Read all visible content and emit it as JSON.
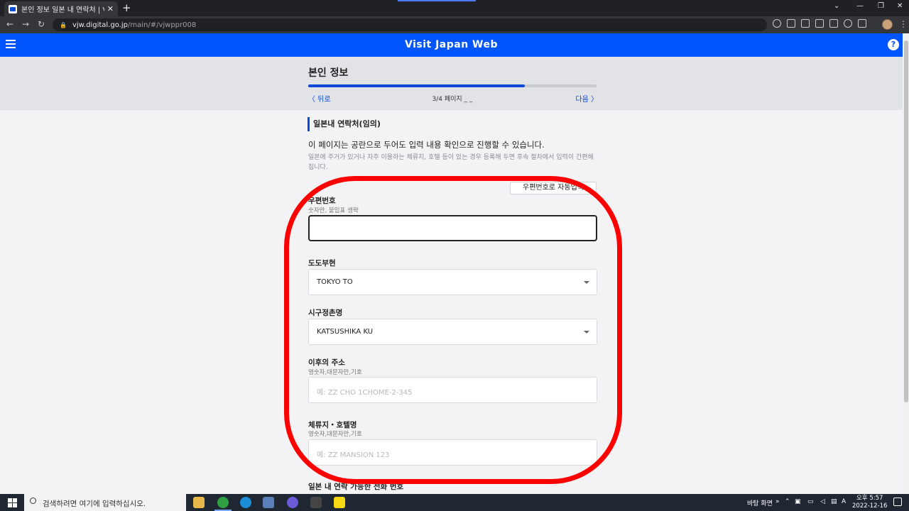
{
  "browser": {
    "tab_title": "본인 정보 일본 내 연락처 | Visit",
    "tab_close": "✕",
    "new_tab": "+",
    "url_host": "vjw.digital.go.jp",
    "url_path": "/main/#/vjwppr008",
    "icons": [
      "google-icon",
      "key-icon",
      "install-icon",
      "translate-icon",
      "share-icon",
      "bookmark-star-icon",
      "sidebar-icon",
      "profile-avatar",
      "menu-icon"
    ]
  },
  "header": {
    "title": "Visit Japan Web",
    "help": "?"
  },
  "step": {
    "heading": "본인 정보",
    "progress": 0.75,
    "back": "〈 뒤로",
    "page_count": "3/4 페이지 _ _",
    "next": "다음 〉"
  },
  "section": {
    "title": "일본내 연락처(임의)",
    "intro": "이 페이지는 공란으로 두어도 입력 내용 확인으로 진행할 수 있습니다.",
    "hint": "일본에 주거가 있거나 자주 이용하는 체류지, 호텔 등이 있는 경우 등록해 두면 후속 절차에서 입력이 간편해집니다."
  },
  "form": {
    "autofill_button": "우편번호로 자동입력",
    "postal": {
      "label": "우편번호",
      "sub": "숫자만, 붙임표 생략",
      "value": ""
    },
    "prefecture": {
      "label": "도도부현",
      "value": "TOKYO TO"
    },
    "city": {
      "label": "시구정촌명",
      "value": "KATSUSHIKA KU"
    },
    "address": {
      "label": "이후의 주소",
      "sub": "영숫자,대문자만,기호",
      "placeholder": "예: ZZ CHO 1CHOME-2-345"
    },
    "hotel": {
      "label": "체류지・호텔명",
      "sub": "영숫자,대문자만,기호",
      "placeholder": "예: ZZ MANSION 123"
    },
    "phone_label_partial": "일본 내 연락 가능한 전화 번호"
  },
  "annotation": {
    "color": "#ff0000"
  },
  "taskbar": {
    "search_placeholder": "검색하려면 여기에 입력하십시오.",
    "desktop_label": "바탕 화면",
    "tray_chevron": "»",
    "ime": "A",
    "time": "오후 5:57",
    "date": "2022-12-16"
  },
  "colors": {
    "brand_blue": "#0055ff",
    "link_blue": "#0b4ad8"
  }
}
